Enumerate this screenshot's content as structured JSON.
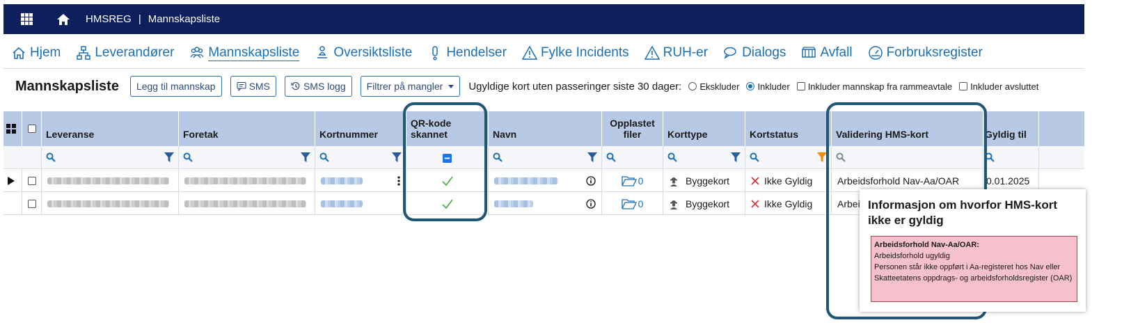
{
  "topbar": {
    "app": "HMSREG",
    "separator": "|",
    "page": "Mannskapsliste"
  },
  "nav": {
    "items": [
      {
        "label": "Hjem",
        "icon": "home-icon"
      },
      {
        "label": "Leverandører",
        "icon": "org-chart-icon"
      },
      {
        "label": "Mannskapsliste",
        "icon": "users-icon"
      },
      {
        "label": "Oversiktsliste",
        "icon": "person-list-icon"
      },
      {
        "label": "Hendelser",
        "icon": "exclamation-icon"
      },
      {
        "label": "Fylke Incidents",
        "icon": "warning-icon"
      },
      {
        "label": "RUH-er",
        "icon": "warning-icon"
      },
      {
        "label": "Dialogs",
        "icon": "chat-icon"
      },
      {
        "label": "Avfall",
        "icon": "container-icon"
      },
      {
        "label": "Forbruksregister",
        "icon": "gauge-icon"
      }
    ]
  },
  "toolbar": {
    "heading": "Mannskapsliste",
    "add_label": "Legg til mannskap",
    "sms_label": "SMS",
    "sms_log_label": "SMS logg",
    "filter_label": "Filtrer på mangler",
    "invalid_cards_label": "Ugyldige kort uten passeringer siste 30 dager:",
    "exclude_label": "Ekskluder",
    "include_label": "Inkluder",
    "include_framework_label": "Inkluder mannskap fra rammeavtale",
    "include_finished_label": "Inkluder avsluttet"
  },
  "table": {
    "columns": {
      "leveranse": "Leveranse",
      "foretak": "Foretak",
      "kortnummer": "Kortnummer",
      "qr": "QR-kode skannet",
      "navn": "Navn",
      "opplastet": "Opplastet filer",
      "korttype": "Korttype",
      "kortstatus": "Kortstatus",
      "validering": "Validering HMS-kort",
      "gyldig": "Gyldig til"
    },
    "rows": [
      {
        "files": "0",
        "korttype": "Byggekort",
        "kortstatus": "Ikke Gyldig",
        "validering": "Arbeidsforhold Nav-Aa/OAR",
        "gyldig": "0.01.2025"
      },
      {
        "files": "0",
        "korttype": "Byggekort",
        "kortstatus": "Ikke Gyldig",
        "validering": "Arbei",
        "gyldig": ""
      }
    ]
  },
  "tooltip": {
    "title": "Informasjon om hvorfor HMS-kort ikke er gyldig",
    "reason_heading": "Arbeidsforhold Nav-Aa/OAR:",
    "line1": "Arbeidsforhold ugyldig",
    "line2": "Personen står ikke oppført i Aa-registeret hos Nav eller Skatteetatens oppdrags- og arbeidsforholdsregister (OAR)"
  },
  "colors": {
    "topbar": "#0d1f5c",
    "link": "#1a6fb5",
    "header": "#b8c9e6",
    "highlight": "#1f5676",
    "tooltip_box": "#f6c0cc",
    "check": "#4caf50",
    "error_x": "#d32f2f"
  }
}
